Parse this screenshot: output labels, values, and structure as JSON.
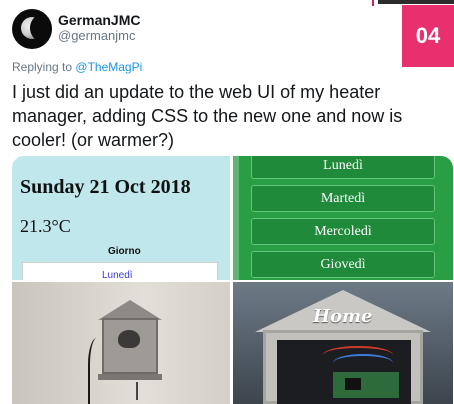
{
  "tweet": {
    "display_name": "GermanJMC",
    "handle": "@germanjmc",
    "reply_prefix": "Replying to",
    "reply_to": "@TheMagPi",
    "text": "I just did an update to the web UI of my heater manager, adding CSS to the new one and now is cooler! (or warmer?)"
  },
  "badge": {
    "number": "04",
    "color": "#e8306e"
  },
  "media": {
    "heater_ui": {
      "date": "Sunday 21 Oct 2018",
      "temperature": "21.3°C",
      "header": "Giorno",
      "first_item": "Lunedì"
    },
    "weekdays": [
      "Lunedì",
      "Martedì",
      "Mercoledì",
      "Giovedì"
    ],
    "home_sign": "Home"
  },
  "colors": {
    "mention": "#1b95e0",
    "secondary_text": "#657786",
    "weekday_button": "#1f8a3a",
    "ui_background": "#bfe7ec"
  }
}
